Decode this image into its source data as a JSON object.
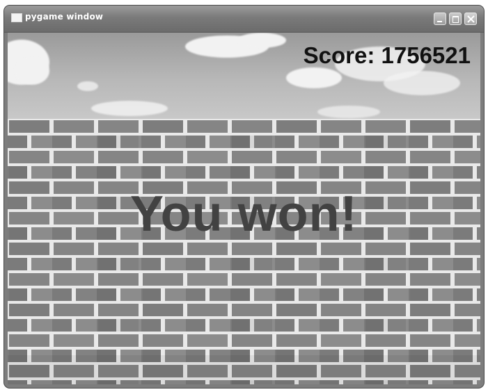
{
  "window": {
    "title": "pygame window"
  },
  "hud": {
    "score_label": "Score: 1756521"
  },
  "game": {
    "message": "You won!"
  },
  "colors": {
    "brick": "#858585",
    "mortar": "#e9e9e9",
    "message_text": "#424242",
    "score_text": "#111111"
  },
  "icons": [
    "app-icon",
    "minimize-icon",
    "maximize-icon",
    "close-icon"
  ]
}
